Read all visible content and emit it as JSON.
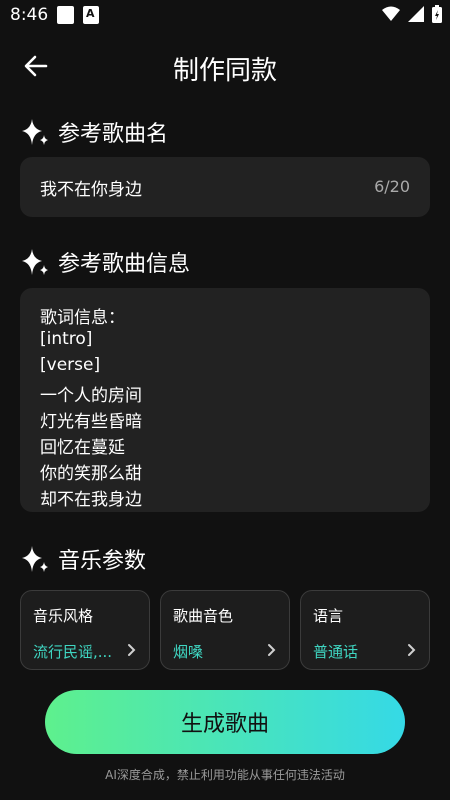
{
  "status": {
    "time": "8:46"
  },
  "header": {
    "title": "制作同款"
  },
  "sections": {
    "song_name_title": "参考歌曲名",
    "song_info_title": "参考歌曲信息",
    "music_params_title": "音乐参数"
  },
  "song_name": {
    "value": "我不在你身边",
    "counter": "6/20"
  },
  "lyrics": {
    "lines": [
      "歌词信息：",
      "[intro]",
      "[verse]",
      "一个人的房间",
      "灯光有些昏暗",
      "回忆在蔓延",
      "你的笑那么甜",
      "却不在我身边"
    ]
  },
  "params": [
    {
      "label": "音乐风格",
      "value": "流行民谣,..."
    },
    {
      "label": "歌曲音色",
      "value": "烟嗓"
    },
    {
      "label": "语言",
      "value": "普通话"
    }
  ],
  "generate_button": {
    "label": "生成歌曲"
  },
  "disclaimer": "AI深度合成，禁止利用功能从事任何违法活动",
  "colors": {
    "accent_teal": "#3fd6c2",
    "gradient_start": "#5ef08d",
    "gradient_end": "#35d9e6"
  }
}
